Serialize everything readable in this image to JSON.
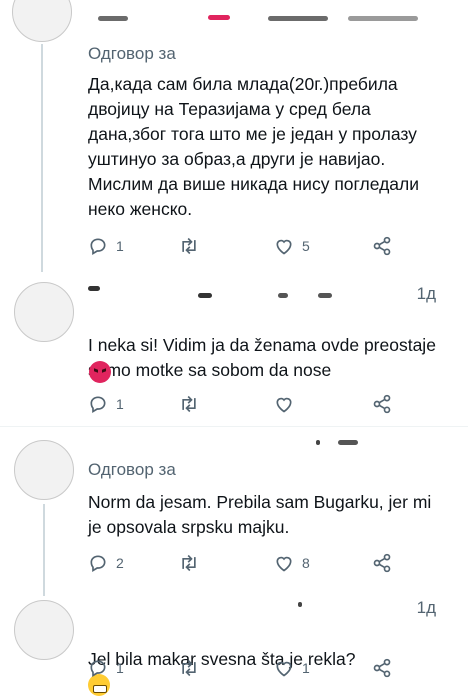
{
  "tweets": [
    {
      "id": "t1",
      "reply_prefix": "Одговор за",
      "time": "",
      "text": "Да,када сам била млада(20г.)пребила двојицу на Теразијама у сред бела дана,због тога што ме је један у пролазу уштинуо за образ,а други је навијао. Мислим да више никада нису погледали неко женско.",
      "replies": "1",
      "retweets": "",
      "likes": "5"
    },
    {
      "id": "t2",
      "reply_prefix": "",
      "time": "1д",
      "text": "I neka si! Vidim ja da ženama ovde preostaje samo motke sa sobom da nose",
      "emoji": "angry-face",
      "replies": "1",
      "retweets": "",
      "likes": ""
    },
    {
      "id": "t3",
      "reply_prefix": "Одговор за",
      "time": "",
      "text": "Norm da jesam. Prebila sam Bugarku, jer mi je opsovala srpsku majku.",
      "replies": "2",
      "retweets": "",
      "likes": "8"
    },
    {
      "id": "t4",
      "reply_prefix": "",
      "time": "1д",
      "text": "Jel bila makar svesna šta je rekla?",
      "emoji": "grimacing-face",
      "replies": "1",
      "retweets": "",
      "likes": "1"
    }
  ]
}
